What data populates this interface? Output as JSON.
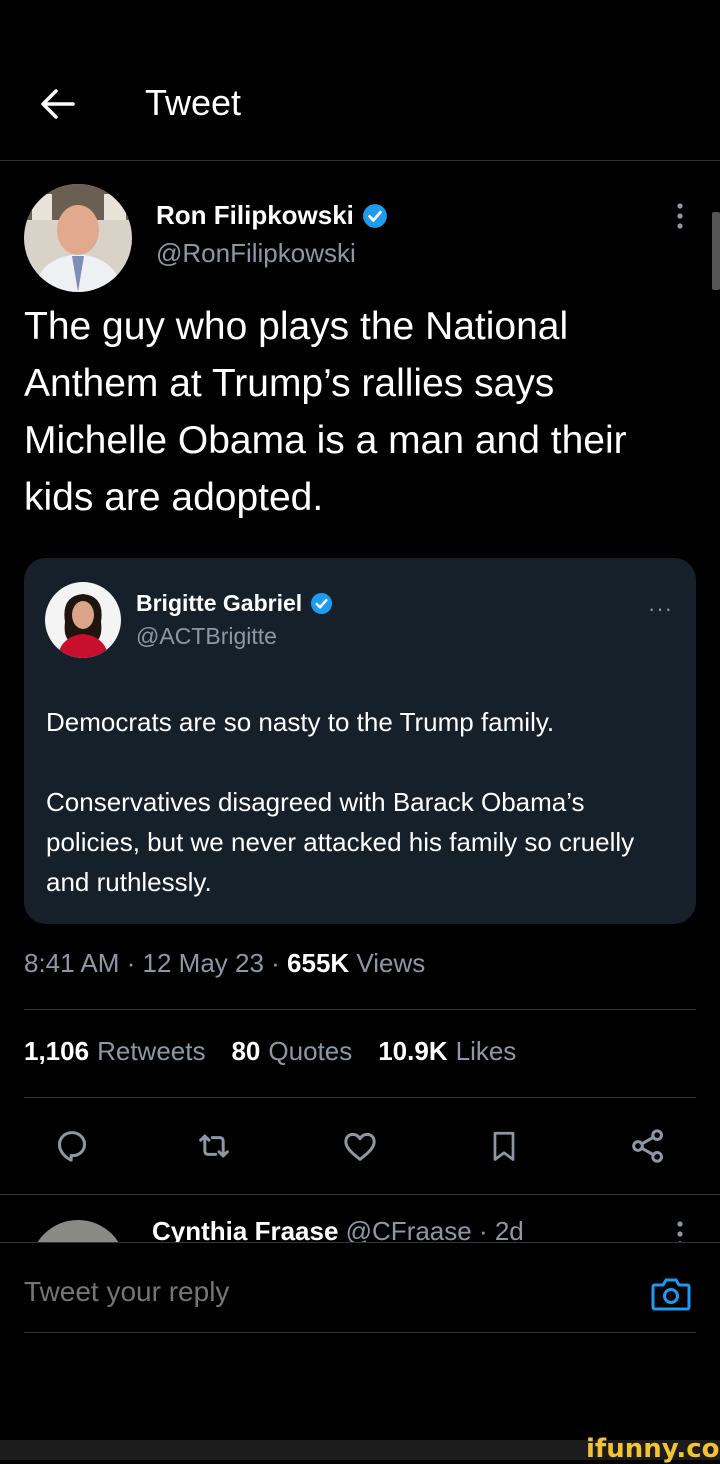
{
  "header": {
    "title": "Tweet",
    "back_icon": "arrow-left-icon"
  },
  "tweet": {
    "author_name": "Ron Filipkowski",
    "author_handle": "@RonFilipkowski",
    "verified": true,
    "text": "The guy who plays the National Anthem at Trump’s rallies says Michelle Obama is a man and their kids are adopted.",
    "quote": {
      "author_name": "Brigitte Gabriel",
      "author_handle": "@ACTBrigitte",
      "verified": true,
      "more": "···",
      "paragraphs": [
        "Democrats are so nasty to the Trump family.",
        "Conservatives disagreed with Barack Obama’s policies, but we never attacked his family so cruelly and ruthlessly."
      ]
    },
    "meta": {
      "time": "8:41 AM",
      "sep": " · ",
      "date": "12 May 23",
      "views_count": "655K",
      "views_label": " Views"
    },
    "stats": {
      "retweets_count": "1,106",
      "retweets_label": "Retweets",
      "quotes_count": "80",
      "quotes_label": "Quotes",
      "likes_count": "10.9K",
      "likes_label": "Likes"
    },
    "actions": [
      "reply-icon",
      "retweet-icon",
      "like-icon",
      "bookmark-icon",
      "share-icon"
    ]
  },
  "reply_preview": {
    "author_name": "Cynthia Fraase",
    "author_handle": "@CFraase",
    "sep": " · ",
    "time": "2d"
  },
  "composer": {
    "placeholder": "Tweet your reply"
  },
  "watermark": "ifunny.co",
  "colors": {
    "background": "#000000",
    "accent": "#1d9bf0",
    "quote_bg": "#15202b",
    "secondary_text": "#8b98a5",
    "watermark": "#f2c230"
  }
}
